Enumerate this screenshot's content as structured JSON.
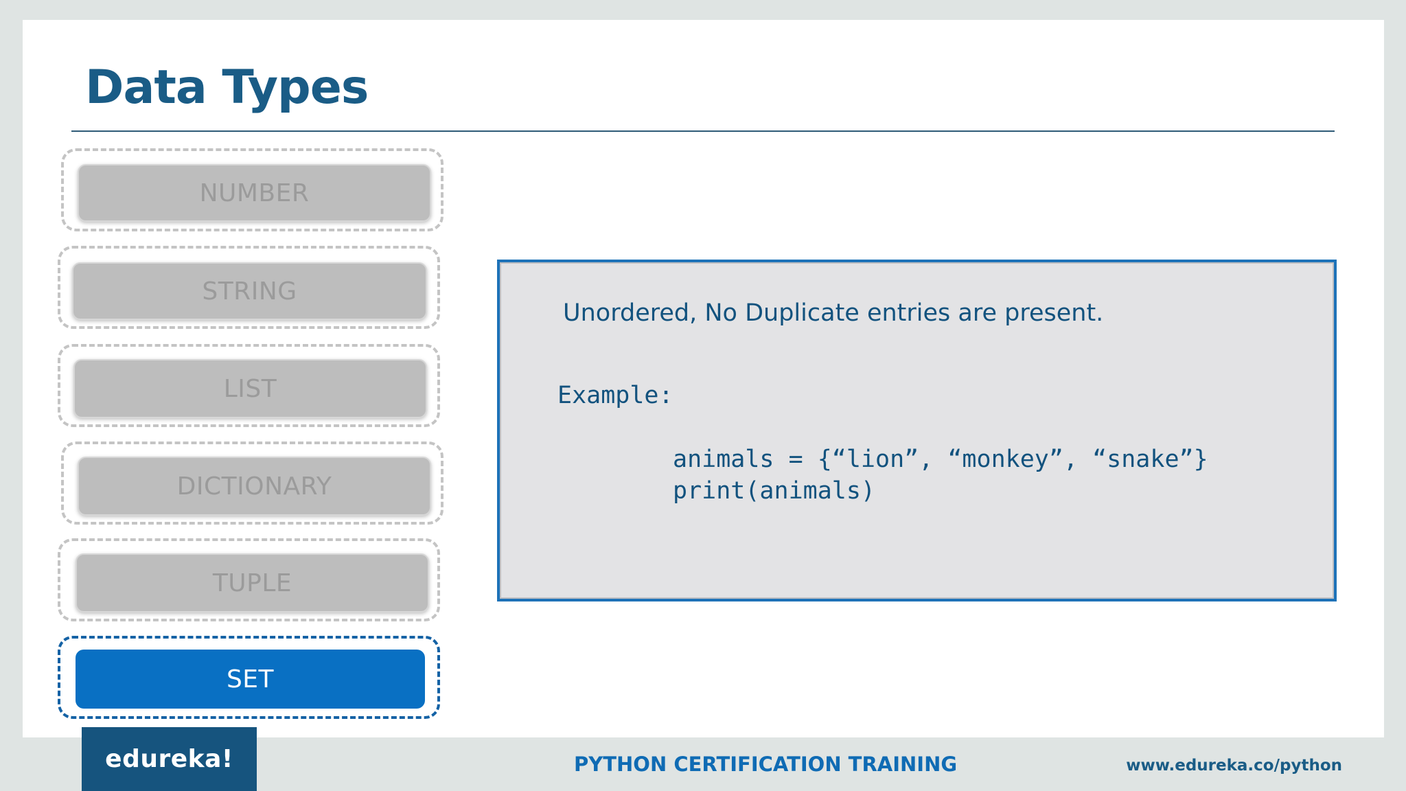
{
  "slide": {
    "title": "Data Types"
  },
  "nav": {
    "items": [
      {
        "label": "NUMBER",
        "active": false
      },
      {
        "label": "STRING",
        "active": false
      },
      {
        "label": "LIST",
        "active": false
      },
      {
        "label": "DICTIONARY",
        "active": false
      },
      {
        "label": "TUPLE",
        "active": false
      },
      {
        "label": "SET",
        "active": true
      }
    ]
  },
  "panel": {
    "description": "Unordered, No Duplicate entries are present.",
    "example_label": "Example:",
    "code_lines": [
      "animals = {“lion”, “monkey”, “snake”}",
      "print(animals)"
    ]
  },
  "footer": {
    "brand": "edureka!",
    "course": "PYTHON CERTIFICATION TRAINING",
    "url": "www.edureka.co/python"
  },
  "colors": {
    "title": "#1a5c86",
    "active_button": "#0970c3",
    "inactive_button": "#bdbdbd",
    "panel_border": "#1d72b8",
    "brand_bg": "#16547e"
  }
}
